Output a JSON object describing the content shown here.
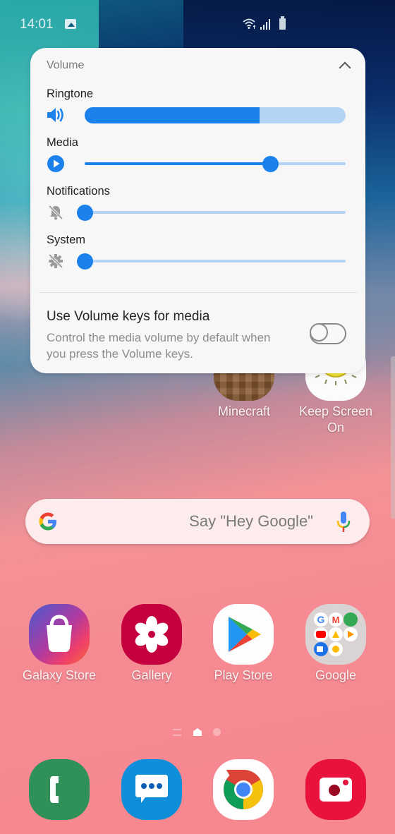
{
  "status_bar": {
    "time": "14:01",
    "icons": [
      "image-notification-icon",
      "wifi-icon",
      "signal-icon",
      "battery-icon"
    ]
  },
  "volume_panel": {
    "title": "Volume",
    "collapse_icon": "chevron-up-icon",
    "streams": [
      {
        "label": "Ringtone",
        "icon": "speaker-icon",
        "level_percent": 67,
        "style": "thick"
      },
      {
        "label": "Media",
        "icon": "play-circle-icon",
        "level_percent": 71,
        "style": "thumb"
      },
      {
        "label": "Notifications",
        "icon": "bell-muted-icon",
        "level_percent": 0,
        "style": "thumb"
      },
      {
        "label": "System",
        "icon": "gear-muted-icon",
        "level_percent": 0,
        "style": "thumb"
      }
    ],
    "volume_keys": {
      "title": "Use Volume keys for media",
      "description": "Control the media volume by default when you press the Volume keys.",
      "enabled": false
    }
  },
  "home": {
    "top_apps": [
      {
        "label": "Minecraft",
        "icon": "minecraft-icon"
      },
      {
        "label": "Keep Screen On",
        "icon": "keep-screen-on-icon"
      }
    ],
    "search": {
      "placeholder": "Say \"Hey Google\"",
      "icons": [
        "google-g-icon",
        "microphone-icon"
      ]
    },
    "apps": [
      {
        "label": "Galaxy Store",
        "icon": "galaxy-store-icon"
      },
      {
        "label": "Gallery",
        "icon": "gallery-icon"
      },
      {
        "label": "Play Store",
        "icon": "play-store-icon"
      },
      {
        "label": "Google",
        "icon": "google-folder-icon"
      }
    ],
    "dock": [
      {
        "name": "Phone",
        "icon": "phone-icon"
      },
      {
        "name": "Messages",
        "icon": "messages-icon"
      },
      {
        "name": "Chrome",
        "icon": "chrome-icon"
      },
      {
        "name": "Camera",
        "icon": "camera-icon"
      }
    ],
    "page_indicator": {
      "pages": 2,
      "current": "home"
    }
  },
  "colors": {
    "accent": "#1a82ea",
    "accent_light": "#b3d4f5",
    "panel_bg": "#f7f7f7"
  }
}
